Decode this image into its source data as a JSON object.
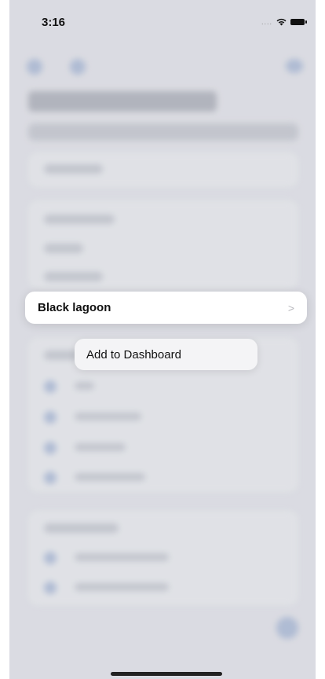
{
  "status_bar": {
    "time": "3:16",
    "signal": "....",
    "wifi_icon": "wifi-icon",
    "battery_icon": "battery-icon"
  },
  "focused_item": {
    "label": "Black lagoon",
    "chevron": ">"
  },
  "context_menu": {
    "items": [
      {
        "label": "Add to Dashboard"
      }
    ]
  }
}
